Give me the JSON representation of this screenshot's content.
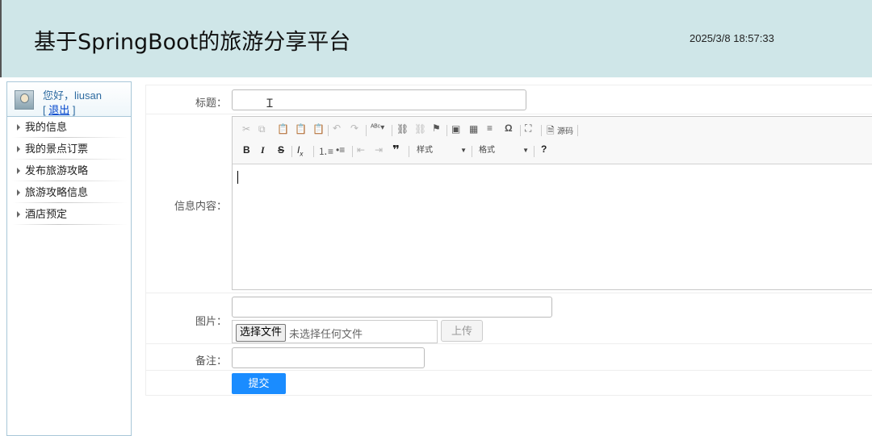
{
  "header": {
    "title": "基于SpringBoot的旅游分享平台",
    "datetime": "2025/3/8 18:57:33"
  },
  "sidebar": {
    "greeting": "您好，liusan",
    "logout_prefix": "[ ",
    "logout_label": "退出",
    "logout_suffix": " ]",
    "items": [
      {
        "label": "我的信息"
      },
      {
        "label": "我的景点订票"
      },
      {
        "label": "发布旅游攻略"
      },
      {
        "label": "旅游攻略信息"
      },
      {
        "label": "酒店预定"
      }
    ]
  },
  "form": {
    "title_label": "标题：",
    "title_value": "",
    "content_label": "信息内容：",
    "editor": {
      "source_label": "源码",
      "styles_label": "样式",
      "format_label": "格式",
      "bold": "B",
      "italic": "I",
      "strike": "S",
      "help": "?"
    },
    "image_label": "图片：",
    "image_path_value": "",
    "choose_file_label": "选择文件",
    "no_file_text": "未选择任何文件",
    "upload_label": "上传",
    "remark_label": "备注：",
    "remark_value": "",
    "submit_label": "提交"
  }
}
